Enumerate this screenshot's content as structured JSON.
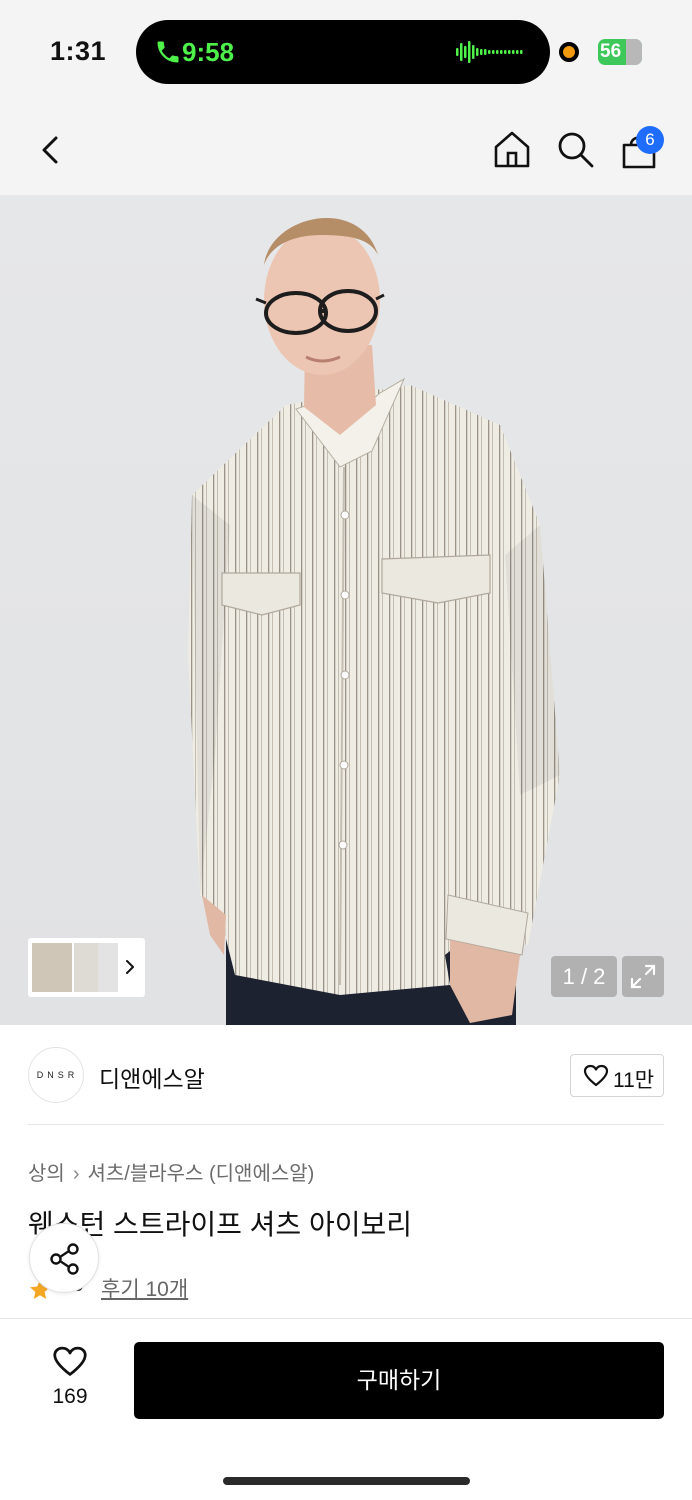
{
  "status_bar": {
    "time": "1:31",
    "call_time": "9:58",
    "battery": "56"
  },
  "nav": {
    "cart_count": "6"
  },
  "gallery": {
    "counter": "1 / 2"
  },
  "brand": {
    "logo_text": "DNSR",
    "name": "디앤에스알",
    "likes": "11만"
  },
  "product": {
    "breadcrumb": [
      "상의",
      "셔츠/블라우스 (디앤에스알)"
    ],
    "title": "웨스턴 스트라이프 셔츠 아이보리",
    "rating": "4.9",
    "reviews_label": "후기 10개"
  },
  "bottom": {
    "wish_count": "169",
    "buy_label": "구매하기"
  },
  "colors": {
    "badge": "#1f6dff",
    "call_green": "#4ef04a",
    "star": "#f5a623",
    "buy_button": "#000000"
  }
}
